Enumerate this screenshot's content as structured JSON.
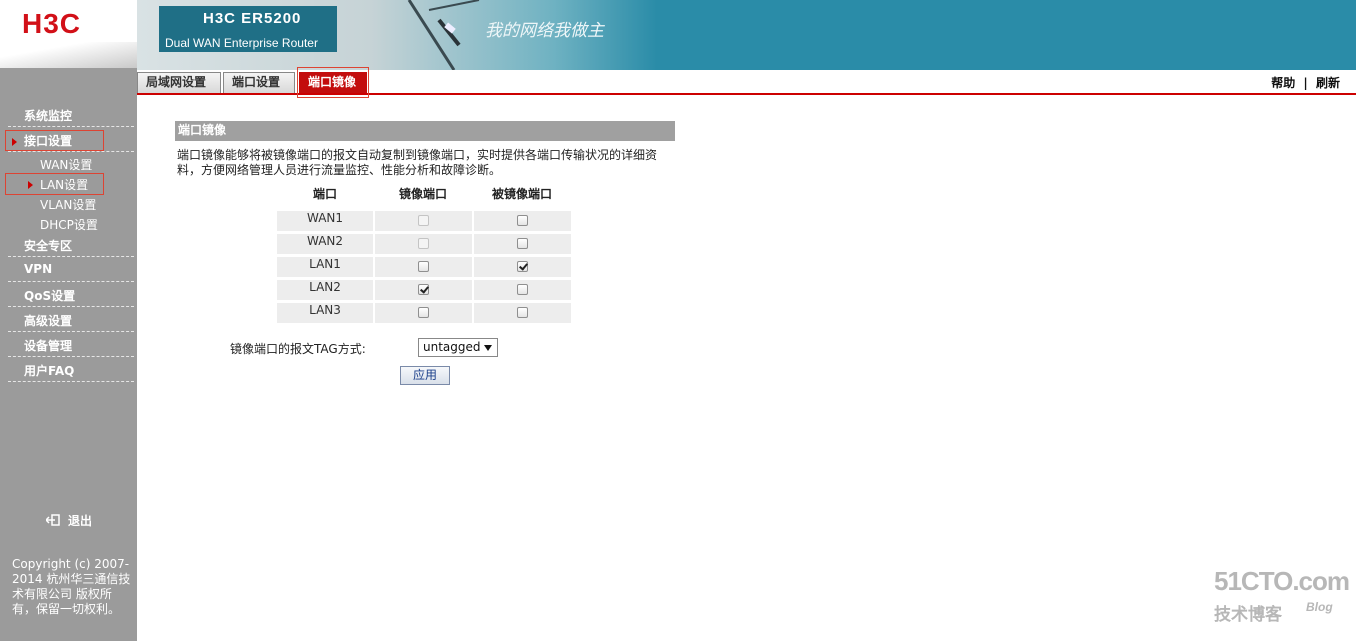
{
  "header": {
    "logo_text": "H3C",
    "product_title": "H3C ER5200",
    "product_subtitle": "Dual WAN Enterprise Router",
    "slogan": "我的网络我做主"
  },
  "tabs": [
    {
      "label": "局域网设置",
      "active": false
    },
    {
      "label": "端口设置",
      "active": false
    },
    {
      "label": "端口镜像",
      "active": true
    }
  ],
  "top_links": {
    "help": "帮助",
    "separator": "|",
    "refresh": "刷新"
  },
  "sidebar": {
    "items": [
      {
        "label": "系统监控"
      },
      {
        "label": "接口设置"
      },
      {
        "label": "WAN设置"
      },
      {
        "label": "LAN设置"
      },
      {
        "label": "VLAN设置"
      },
      {
        "label": "DHCP设置"
      },
      {
        "label": "安全专区"
      },
      {
        "label": "VPN"
      },
      {
        "label": "QoS设置"
      },
      {
        "label": "高级设置"
      },
      {
        "label": "设备管理"
      },
      {
        "label": "用户FAQ"
      }
    ],
    "logout_label": "退出",
    "copyright": "Copyright (c) 2007-2014 杭州华三通信技术有限公司 版权所有，保留一切权利。"
  },
  "content": {
    "section_title": "端口镜像",
    "description": "端口镜像能够将被镜像端口的报文自动复制到镜像端口，实时提供各端口传输状况的详细资料，方便网络管理人员进行流量监控、性能分析和故障诊断。",
    "columns": {
      "port": "端口",
      "mirror": "镜像端口",
      "mirrored": "被镜像端口"
    },
    "rows": [
      {
        "port": "WAN1",
        "mirror": false,
        "mirror_disabled": true,
        "mirrored": false
      },
      {
        "port": "WAN2",
        "mirror": false,
        "mirror_disabled": true,
        "mirrored": false
      },
      {
        "port": "LAN1",
        "mirror": false,
        "mirror_disabled": false,
        "mirrored": true
      },
      {
        "port": "LAN2",
        "mirror": true,
        "mirror_disabled": false,
        "mirrored": false
      },
      {
        "port": "LAN3",
        "mirror": false,
        "mirror_disabled": false,
        "mirrored": false
      }
    ],
    "tag_label": "镜像端口的报文TAG方式:",
    "tag_value": "untagged",
    "apply_label": "应用"
  },
  "watermark": {
    "site": "51CTO.com",
    "blog_cn": "技术博客",
    "blog_en": "Blog"
  },
  "colors": {
    "accent_red": "#c30d0d",
    "banner_teal": "#2a8ca8",
    "sidebar_gray": "#9b9b9b"
  },
  "icons": [
    "logout-icon",
    "chevron-right-icon"
  ]
}
